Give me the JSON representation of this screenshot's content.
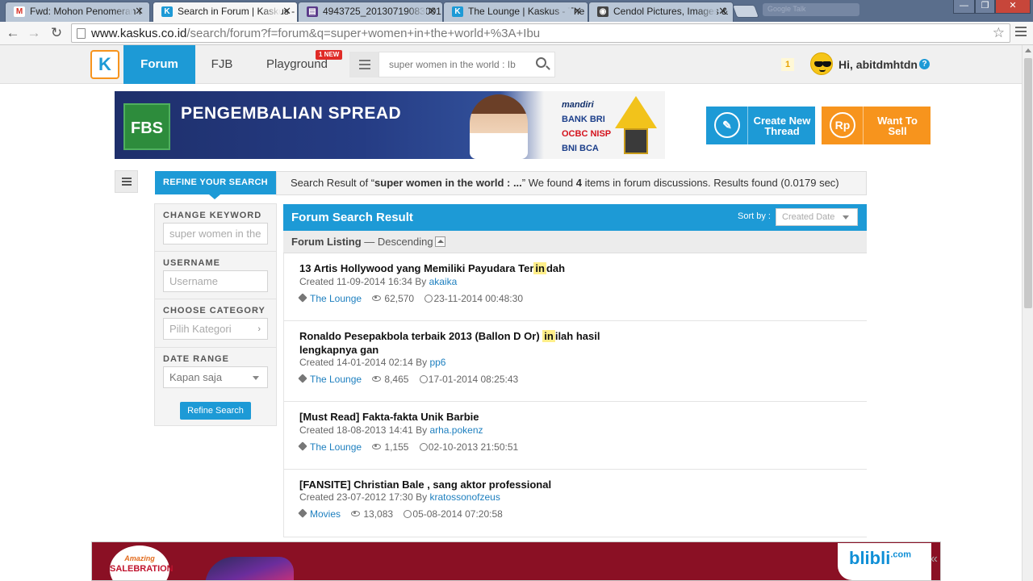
{
  "browser": {
    "tabs": [
      {
        "title": "Fwd: Mohon Penomeran I",
        "favicon": "M",
        "color": "#d93025"
      },
      {
        "title": "Search in Forum | Kaskus - ",
        "favicon": "K",
        "color": "#1d9ad6",
        "active": true
      },
      {
        "title": "4943725_20130719083001.j",
        "favicon": "▤",
        "color": "#5b3a8a"
      },
      {
        "title": "The Lounge | Kaskus - The",
        "favicon": "K",
        "color": "#1d9ad6"
      },
      {
        "title": "Cendol Pictures, Images &",
        "favicon": "◉",
        "color": "#444444"
      }
    ],
    "hidden_tab_label": "Google Talk",
    "url_host": "www.kaskus.co.id",
    "url_path": "/search/forum?f=forum&q=super+women+in+the+world+%3A+Ibu",
    "window_buttons": [
      "—",
      "❐",
      "✕"
    ]
  },
  "header": {
    "logo": "K",
    "nav": [
      {
        "label": "Forum",
        "active": true
      },
      {
        "label": "FJB"
      },
      {
        "label": "Playground"
      }
    ],
    "new_badge": "1 NEW",
    "search_value": "super women in the world : Ib",
    "notification_count": "1",
    "greeting": "Hi, abitdmhtdn",
    "help": "?"
  },
  "banner": {
    "brand": "FBS",
    "title": "PENGEMBALIAN SPREAD",
    "banks": [
      "mandiri",
      "BANK BRI",
      "OCBC NISP",
      "BNI  BCA"
    ]
  },
  "actions": {
    "create_thread": "Create New Thread",
    "want_to_sell": "Want To Sell",
    "rp": "Rp"
  },
  "refine": {
    "tab_label": "REFINE YOUR SEARCH",
    "summary_prefix": "Search Result of “",
    "summary_query": "super women in the world : ...",
    "summary_mid": "” We found ",
    "summary_count": "4",
    "summary_suffix": " items in forum discussions. Results found (0.0179 sec)"
  },
  "sidebar": {
    "keyword_label": "CHANGE KEYWORD",
    "keyword_value": "super women in the",
    "username_label": "USERNAME",
    "username_placeholder": "Username",
    "category_label": "CHOOSE CATEGORY",
    "category_placeholder": "Pilih Kategori",
    "date_label": "DATE RANGE",
    "date_value": "Kapan saja",
    "button": "Refine Search"
  },
  "results": {
    "title": "Forum Search Result",
    "sort_label": "Sort by :",
    "sort_value": "Created Date",
    "listing_label": "Forum Listing",
    "listing_order": "— Descending",
    "items": [
      {
        "title_before": "13 Artis Hollywood yang Memiliki Payudara Ter",
        "highlight": "in",
        "title_after": "dah",
        "created": "Created 11-09-2014 16:34 By ",
        "author": "akaika",
        "category": "The Lounge",
        "views": "62,570",
        "last": "23-11-2014 00:48:30"
      },
      {
        "title_before": "Ronaldo Pesepakbola terbaik 2013 (Ballon D Or) ",
        "highlight": "in",
        "title_after": "ilah hasil lengkapnya gan",
        "created": "Created 14-01-2014 02:14 By ",
        "author": "pp6",
        "category": "The Lounge",
        "views": "8,465",
        "last": "17-01-2014 08:25:43"
      },
      {
        "title_before": "[Must Read] Fakta-fakta Unik Barbie",
        "highlight": "",
        "title_after": "",
        "created": "Created 18-08-2013 14:41 By ",
        "author": "arha.pokenz",
        "category": "The Lounge",
        "views": "1,155",
        "last": "02-10-2013 21:50:51"
      },
      {
        "title_before": "[FANSITE] Christian Bale , sang aktor professional",
        "highlight": "",
        "title_after": "",
        "created": "Created 23-07-2012 17:30 By ",
        "author": "kratossonofzeus",
        "category": "Movies",
        "views": "13,083",
        "last": "05-08-2014 07:20:58"
      }
    ]
  },
  "bottom_ad": {
    "badge_top": "Amazing",
    "badge_main": "SALEBRATION",
    "brand": "blibli",
    "brand_suffix": ".com",
    "collapse": "«"
  }
}
